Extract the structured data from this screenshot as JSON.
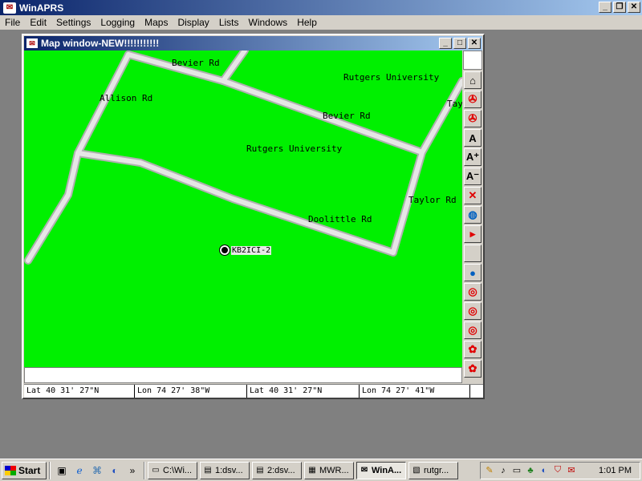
{
  "app": {
    "title": "WinAPRS",
    "logo": "aprs-logo-icon",
    "min": "_",
    "restore": "❐",
    "close": "✕"
  },
  "menu": [
    "File",
    "Edit",
    "Settings",
    "Logging",
    "Maps",
    "Display",
    "Lists",
    "Windows",
    "Help"
  ],
  "map_window": {
    "title": "Map window-NEW!!!!!!!!!!!",
    "min": "_",
    "max": "□",
    "close": "✕",
    "labels": {
      "bevier1": "Bevier Rd",
      "rutgers1": "Rutgers University",
      "allison": "Allison Rd",
      "taylor_top": "Tay",
      "bevier2": "Bevier Rd",
      "rutgers2": "Rutgers University",
      "taylor": "Taylor Rd",
      "doolittle": "Doolittle Rd"
    },
    "station": {
      "callsign": "KB2ICI-2"
    },
    "colors": {
      "land": "#00f000",
      "road": "#e0e0e0",
      "road_edge": "#b0b0b0"
    },
    "toolbar": [
      {
        "name": "home-icon",
        "glyph": "⌂",
        "class": ""
      },
      {
        "name": "vehicle-icon",
        "glyph": "✇",
        "class": "red"
      },
      {
        "name": "vehicle-alt-icon",
        "glyph": "✇",
        "class": "red"
      },
      {
        "name": "font-icon",
        "glyph": "A",
        "class": ""
      },
      {
        "name": "font-larger-icon",
        "glyph": "A⁺",
        "class": ""
      },
      {
        "name": "font-smaller-icon",
        "glyph": "A⁻",
        "class": ""
      },
      {
        "name": "cancel-icon",
        "glyph": "✕",
        "class": "red"
      },
      {
        "name": "globe-icon",
        "glyph": "◍",
        "class": "blue"
      },
      {
        "name": "flag-icon",
        "glyph": "▸",
        "class": "red"
      },
      {
        "name": "blank-icon",
        "glyph": "",
        "class": ""
      },
      {
        "name": "balloon-icon",
        "glyph": "●",
        "class": "blue"
      },
      {
        "name": "target-icon",
        "glyph": "◎",
        "class": "red"
      },
      {
        "name": "target-icon-2",
        "glyph": "◎",
        "class": "red"
      },
      {
        "name": "target-icon-3",
        "glyph": "◎",
        "class": "red"
      },
      {
        "name": "tree-icon",
        "glyph": "✿",
        "class": "red"
      },
      {
        "name": "tree-icon-2",
        "glyph": "✿",
        "class": "red"
      }
    ],
    "status": {
      "lat1": "Lat  40 31' 27\"N",
      "lon1": "Lon  74 27' 38\"W",
      "lat2": "Lat  40 31' 27\"N",
      "lon2": "Lon  74 27' 41\"W"
    }
  },
  "taskbar": {
    "start": "Start",
    "quick": [
      "desktop-icon",
      "ie-icon",
      "network-icon",
      "chat-icon"
    ],
    "more": "»",
    "tasks": [
      {
        "label": "C:\\Wi...",
        "icon": "folder-icon",
        "active": false
      },
      {
        "label": "1:dsv...",
        "icon": "document-icon",
        "active": false
      },
      {
        "label": "2:dsv...",
        "icon": "document-icon",
        "active": false
      },
      {
        "label": "MWR...",
        "icon": "app-icon",
        "active": false
      },
      {
        "label": "WinA...",
        "icon": "aprs-logo-icon",
        "active": true
      },
      {
        "label": "rutgr...",
        "icon": "image-icon",
        "active": false
      }
    ],
    "clock": "1:01 PM"
  }
}
